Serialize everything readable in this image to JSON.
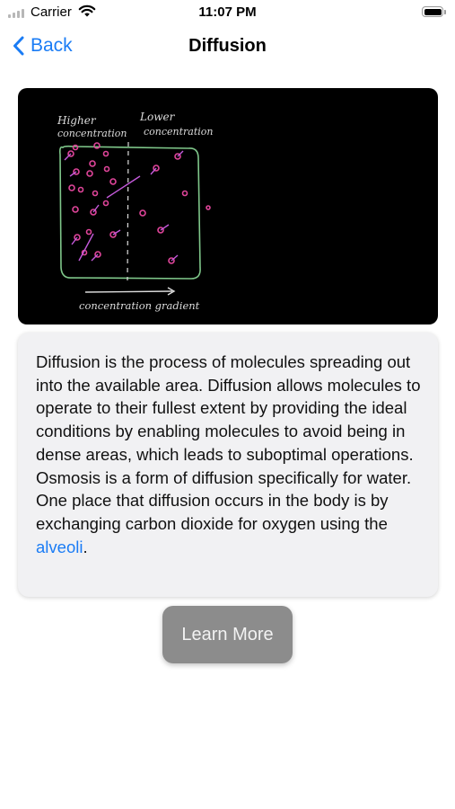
{
  "status_bar": {
    "carrier": "Carrier",
    "time": "11:07 PM"
  },
  "nav": {
    "back_label": "Back",
    "title": "Diffusion"
  },
  "video": {
    "label_higher_1": "Higher",
    "label_higher_2": "concentration",
    "label_lower_1": "Lower",
    "label_lower_2": "concentration",
    "label_gradient": "concentration gradient"
  },
  "description": {
    "text": "Diffusion is the process of molecules spreading out into the available area. Diffusion allows molecules to operate to their fullest extent by providing the ideal conditions by enabling molecules to avoid being in dense areas, which leads to suboptimal operations. Osmosis is a form of diffusion specifically for water. One place that diffusion occurs in the body is by exchanging carbon dioxide for oxygen using the ",
    "link_text": "alveoli",
    "end_punct": "."
  },
  "learn_more_label": "Learn More",
  "colors": {
    "accent": "#1a7cf5",
    "card_bg": "#f1f1f3",
    "button_bg": "#8c8c8c",
    "chalk_green": "#7fc78a",
    "molecule_pink": "#e0459a"
  },
  "icons": {
    "back": "chevron-left-icon",
    "wifi": "wifi-icon",
    "signal": "cellular-signal-icon",
    "battery": "battery-icon"
  }
}
